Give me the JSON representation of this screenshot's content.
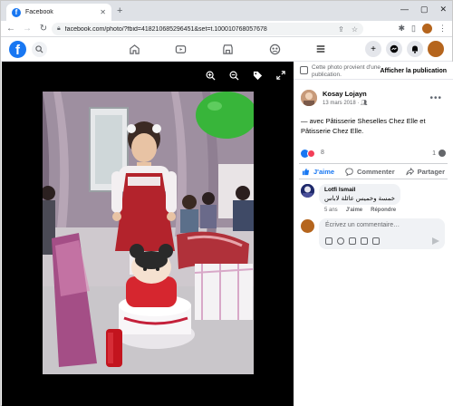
{
  "browser": {
    "tab_title": "Facebook",
    "tab_favicon": "f",
    "new_tab_icon": "plus-icon",
    "window_controls": [
      "minimize-icon",
      "maximize-icon",
      "close-icon"
    ],
    "url": "facebook.com/photo/?fbid=418210685296451&set=t.100010768057678"
  },
  "facebook": {
    "logo_letter": "f",
    "nav_icons": [
      "home-icon",
      "watch-icon",
      "marketplace-icon",
      "groups-icon",
      "menu-icon"
    ],
    "right_icons": [
      "create-icon",
      "messenger-icon",
      "notifications-icon",
      "account-avatar"
    ]
  },
  "viewer": {
    "tools": [
      "zoom-in-icon",
      "zoom-out-icon",
      "tag-icon",
      "fullscreen-icon"
    ]
  },
  "panel": {
    "context_text": "Cette photo provient d'une publication.",
    "context_link": "Afficher la publication",
    "author_name": "Kosay Lojayn",
    "post_date": "13 mars 2018",
    "post_date_sep": "·",
    "caption": "— avec Pâtisserie Sheselles Chez Elle et Pâtisserie Chez Elle.",
    "reaction_count": "8",
    "comment_count": "1",
    "actions": {
      "like": "J'aime",
      "comment": "Commenter",
      "share": "Partager"
    },
    "comment": {
      "author": "Lotfi Ismail",
      "text": "خمسة وخميس عائلة لاباس",
      "age": "5 ans",
      "like": "J'aime",
      "reply": "Répondre"
    },
    "write_placeholder": "Écrivez un commentaire…"
  },
  "colors": {
    "facebook_blue": "#1877f2",
    "love_red": "#f33e58",
    "viewer_bg": "#000000"
  }
}
